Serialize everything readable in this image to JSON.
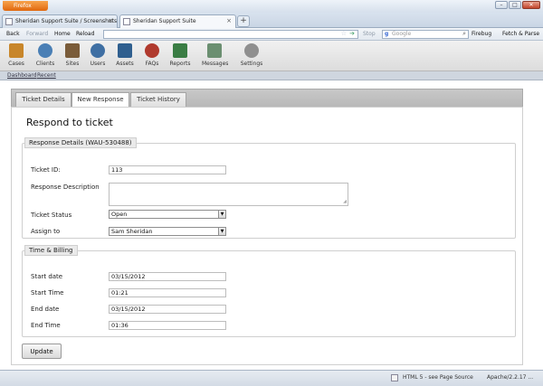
{
  "browser": {
    "menu_button": "Firefox",
    "win_minimize": "–",
    "win_restore": "□",
    "win_close": "✕",
    "tabs": [
      {
        "label": "Sheridan Support Suite / Screenshots",
        "close": "×"
      },
      {
        "label": "Sheridan Support Suite",
        "close": "×"
      }
    ],
    "new_tab": "+",
    "nav": {
      "back": "Back",
      "forward": "Forward",
      "home": "Home",
      "reload": "Reload",
      "stop": "Stop"
    },
    "search_placeholder": "Google",
    "firebug": "Firebug",
    "fetch_parse": "Fetch & Parse"
  },
  "toolbar": {
    "items": [
      {
        "label": "Cases",
        "color": "#c8862a"
      },
      {
        "label": "Clients",
        "color": "#4a7fb5"
      },
      {
        "label": "Sites",
        "color": "#7a5c3a"
      },
      {
        "label": "Users",
        "color": "#3f6fa3"
      },
      {
        "label": "Assets",
        "color": "#2f5f8f"
      },
      {
        "label": "FAQs",
        "color": "#b03a2e"
      },
      {
        "label": "Reports",
        "color": "#3a7d44"
      },
      {
        "label": "Messages",
        "color": "#6b8f71"
      },
      {
        "label": "Settings",
        "color": "#8f8f8f"
      }
    ]
  },
  "links": {
    "dashboard": "Dashboard",
    "recent": "Recent"
  },
  "tabs": [
    {
      "label": "Ticket Details"
    },
    {
      "label": "New Response"
    },
    {
      "label": "Ticket History"
    }
  ],
  "page": {
    "title": "Respond to ticket"
  },
  "response": {
    "legend": "Response Details (WAU-530488)",
    "ticket_id_label": "Ticket ID:",
    "ticket_id_value": "113",
    "description_label": "Response Description",
    "description_value": "",
    "status_label": "Ticket Status",
    "status_value": "Open",
    "assign_label": "Assign to",
    "assign_value": "Sam Sheridan"
  },
  "billing": {
    "legend": "Time & Billing",
    "start_date_label": "Start date",
    "start_date_value": "03/15/2012",
    "start_time_label": "Start Time",
    "start_time_value": "01:21",
    "end_date_label": "End date",
    "end_date_value": "03/15/2012",
    "end_time_label": "End Time",
    "end_time_value": "01:36"
  },
  "actions": {
    "update": "Update"
  },
  "status": {
    "html5": "HTML 5 - see Page Source",
    "server": "Apache/2.2.17 ..."
  }
}
